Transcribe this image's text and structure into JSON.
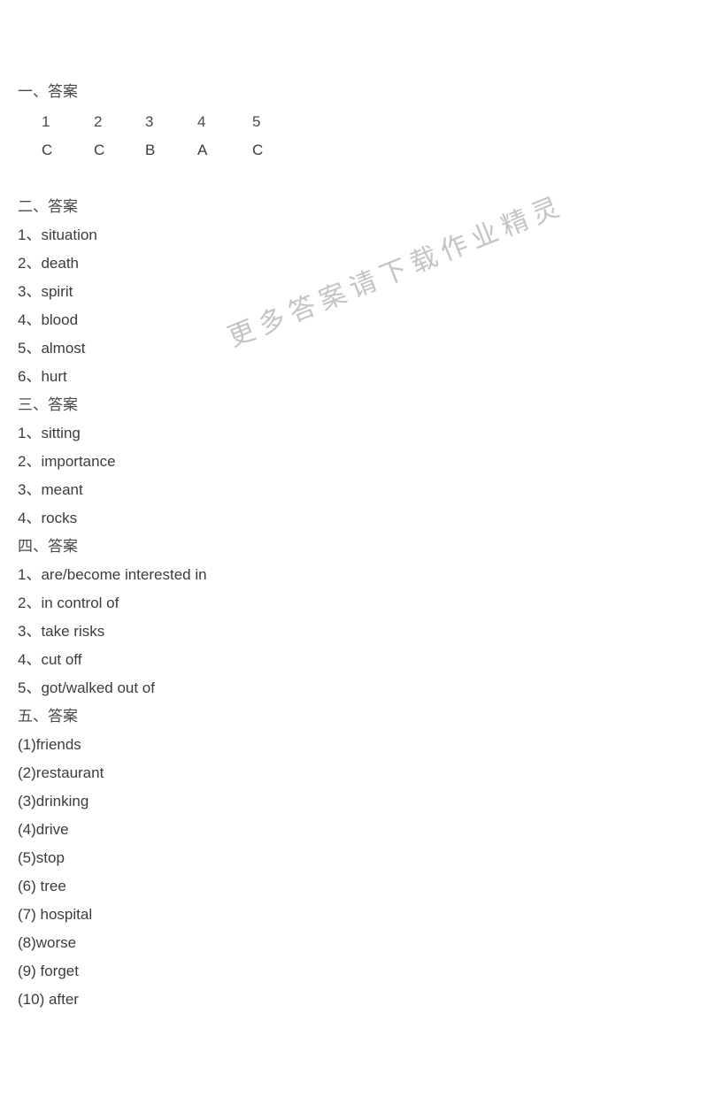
{
  "watermark": {
    "text": "更多答案请下载作业精灵"
  },
  "sections": [
    {
      "heading": "一、答案",
      "type": "grid",
      "numbers": [
        "1",
        "2",
        "3",
        "4",
        "5"
      ],
      "answers": [
        "C",
        "C",
        "B",
        "A",
        "C"
      ]
    },
    {
      "heading": "二、答案",
      "type": "list",
      "items": [
        "1、situation",
        "2、death",
        "3、spirit",
        "4、blood",
        "5、almost",
        "6、hurt"
      ]
    },
    {
      "heading": "三、答案",
      "type": "list",
      "items": [
        "1、sitting",
        "2、importance",
        "3、meant",
        "4、rocks"
      ]
    },
    {
      "heading": "四、答案",
      "type": "list",
      "items": [
        "1、are/become interested in",
        "2、in control of",
        "3、take risks",
        "4、cut off",
        "5、got/walked out of"
      ]
    },
    {
      "heading": "五、答案",
      "type": "list",
      "items": [
        "(1)friends",
        "(2)restaurant",
        "(3)drinking",
        "(4)drive",
        "(5)stop",
        "(6) tree",
        "(7) hospital",
        "(8)worse",
        "(9) forget",
        "(10) after"
      ]
    }
  ]
}
